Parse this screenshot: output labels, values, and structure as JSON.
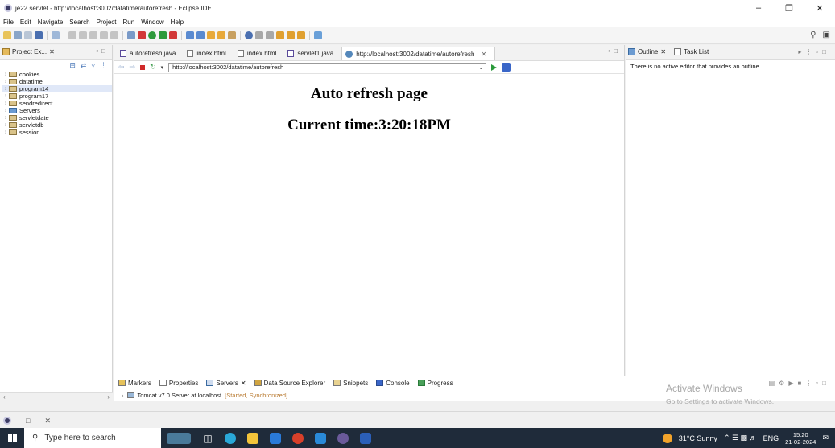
{
  "window": {
    "title": "je22 servlet - http://localhost:3002/datatime/autorefresh - Eclipse IDE"
  },
  "menu": [
    "File",
    "Edit",
    "Navigate",
    "Search",
    "Project",
    "Run",
    "Window",
    "Help"
  ],
  "project_explorer": {
    "tab_label": "Project Ex...",
    "items": [
      {
        "label": "cookies",
        "kind": "project"
      },
      {
        "label": "datatime",
        "kind": "project"
      },
      {
        "label": "program14",
        "kind": "project",
        "selected": true
      },
      {
        "label": "program17",
        "kind": "project"
      },
      {
        "label": "sendredirect",
        "kind": "project"
      },
      {
        "label": "Servers",
        "kind": "servers"
      },
      {
        "label": "servletdate",
        "kind": "project"
      },
      {
        "label": "servletdb",
        "kind": "project"
      },
      {
        "label": "session",
        "kind": "project"
      }
    ]
  },
  "editor": {
    "tabs": [
      {
        "label": "autorefresh.java",
        "icon": "java-file-icon",
        "active": false
      },
      {
        "label": "index.html",
        "icon": "html-file-icon",
        "active": false
      },
      {
        "label": "index.html",
        "icon": "html-file-icon",
        "active": false
      },
      {
        "label": "servlet1.java",
        "icon": "java-file-icon",
        "active": false
      },
      {
        "label": "http://localhost:3002/datatime/autorefresh",
        "icon": "globe-icon",
        "active": true
      }
    ],
    "url": "http://localhost:3002/datatime/autorefresh",
    "page": {
      "heading": "Auto refresh page",
      "time_line": "Current time:3:20:18PM"
    }
  },
  "outline": {
    "tabs": [
      "Outline",
      "Task List"
    ],
    "message": "There is no active editor that provides an outline."
  },
  "servers_panel": {
    "tabs": [
      "Markers",
      "Properties",
      "Servers",
      "Data Source Explorer",
      "Snippets",
      "Console",
      "Progress"
    ],
    "server_name": "Tomcat v7.0 Server at localhost",
    "server_status": "[Started, Synchronized]"
  },
  "watermark": {
    "line1": "Activate Windows",
    "line2": "Go to Settings to activate Windows."
  },
  "taskbar": {
    "search_placeholder": "Type here to search",
    "weather": "31°C  Sunny",
    "language": "ENG",
    "time": "15:20",
    "date": "21-02-2024"
  },
  "colors": {
    "taskbar_bg": "#1f2b3a",
    "selection": "#e0e8f8",
    "server_status": "#b87a30"
  }
}
